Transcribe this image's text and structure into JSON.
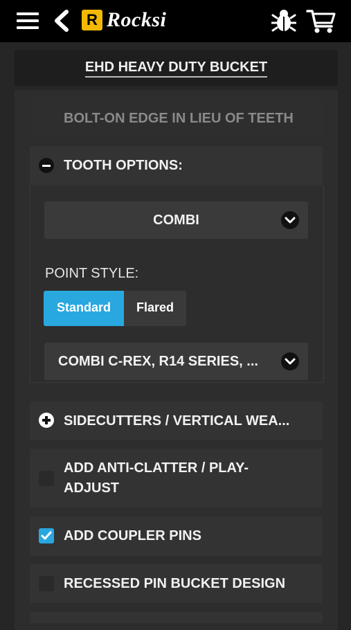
{
  "header": {
    "brand_letter": "R",
    "brand_name": "Rocksi",
    "menu_icon": "hamburger-icon",
    "back_icon": "back-icon",
    "bug_icon": "bug-icon",
    "cart_icon": "cart-icon"
  },
  "product": {
    "title": "EHD HEAVY DUTY BUCKET"
  },
  "options": {
    "bolt_on_edge": "BOLT-ON EDGE IN LIEU OF TEETH",
    "tooth_options": {
      "label": "TOOTH OPTIONS:",
      "type_select": "COMBI",
      "point_style_label": "POINT STYLE:",
      "point_styles": [
        "Standard",
        "Flared"
      ],
      "selected_point_style": "Standard",
      "series_select": "COMBI C-REX, R14 SERIES, ..."
    },
    "sidecutters": "SIDECUTTERS / VERTICAL WEA...",
    "anti_clatter_line1": "ADD ANTI-CLATTER / PLAY-",
    "anti_clatter_line2": "ADJUST",
    "coupler_pins": "ADD COUPLER PINS",
    "recessed_pin": "RECESSED PIN BUCKET DESIGN"
  },
  "colors": {
    "accent": "#29a8e0",
    "brand": "#f3b800",
    "topbar": "#000000",
    "background": "#262626"
  }
}
